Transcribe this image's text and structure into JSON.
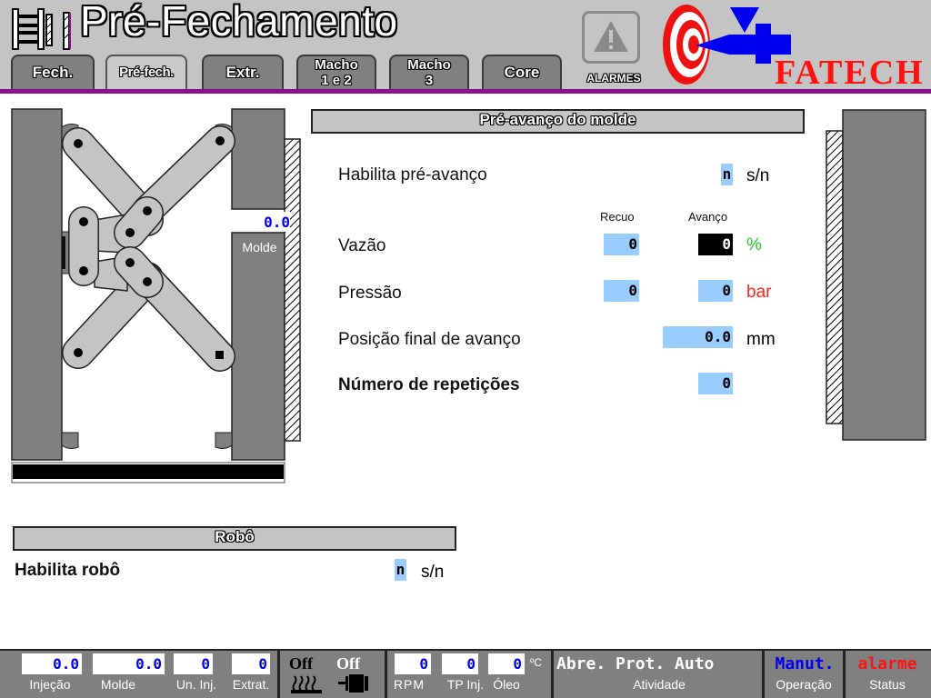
{
  "header": {
    "title": "Pré-Fechamento",
    "tabs": [
      {
        "label": "Fech.",
        "active": false
      },
      {
        "label": "Pré-fech.",
        "active": true
      },
      {
        "label": "Extr.",
        "active": false
      },
      {
        "label_line1": "Macho",
        "label_line2": "1 e 2",
        "active": false
      },
      {
        "label_line1": "Macho",
        "label_line2": "3",
        "active": false
      },
      {
        "label": "Core",
        "active": false
      }
    ],
    "alarms_label": "ALARMES",
    "logo_text": "FATECH"
  },
  "machine_diagram": {
    "mold_value": "0.0",
    "mold_label": "Molde"
  },
  "pre_advance": {
    "title": "Pré-avanço do molde",
    "enable_label": "Habilita pré-avanço",
    "enable_value": "n",
    "enable_unit": "s/n",
    "col_recuo": "Recuo",
    "col_avanco": "Avanço",
    "flow_label": "Vazão",
    "flow_recuo": "0",
    "flow_avanco": "0",
    "flow_unit": "%",
    "pressure_label": "Pressão",
    "pressure_recuo": "0",
    "pressure_avanco": "0",
    "pressure_unit": "bar",
    "final_pos_label": "Posição final de avanço",
    "final_pos_value": "0.0",
    "final_pos_unit": "mm",
    "repetitions_label": "Número de repetições",
    "repetitions_value": "0"
  },
  "robot": {
    "title": "Robô",
    "enable_label": "Habilita robô",
    "enable_value": "n",
    "enable_unit": "s/n"
  },
  "status_bar": {
    "injecao_value": "0.0",
    "injecao_label": "Injeção",
    "molde_value": "0.0",
    "molde_label": "Molde",
    "un_inj_value": "0",
    "un_inj_label": "Un. Inj.",
    "extrat_value": "0",
    "extrat_label": "Extrat.",
    "heater_state": "Off",
    "motor_state": "Off",
    "rpm_value": "0",
    "rpm_label": "RPM",
    "tp_inj_value": "0",
    "tp_inj_label": "TP Inj.",
    "oleo_value": "0",
    "oleo_label": "Óleo",
    "oleo_unit": "ºC",
    "activity_value": "Abre. Prot. Auto",
    "activity_label": "Atividade",
    "operation_value": "Manut.",
    "operation_label": "Operação",
    "status_value": "alarme",
    "status_label": "Status"
  },
  "colors": {
    "accent_purple": "#8b0f8b",
    "field_blue": "#99ccff",
    "percent_green": "#22cc22",
    "bar_red": "#ff2222",
    "logo_red": "#ff1111",
    "logo_blue": "#0000ee"
  }
}
